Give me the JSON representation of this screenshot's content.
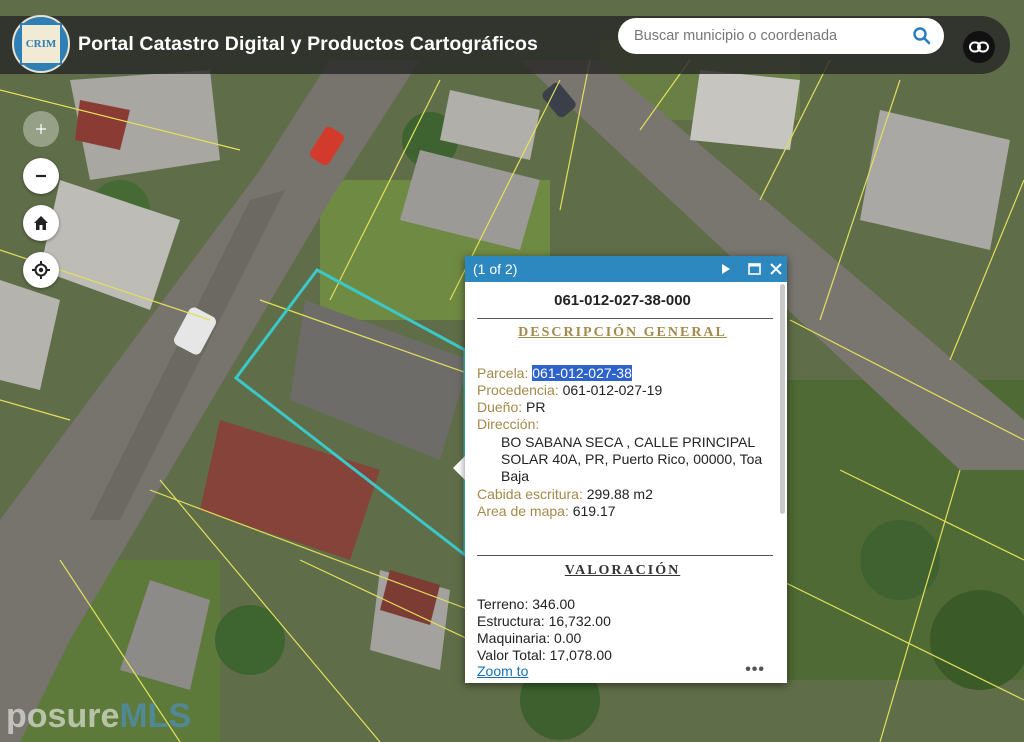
{
  "header": {
    "logo_text": "CRIM",
    "title": "Portal Catastro Digital y Productos Cartográficos",
    "search_placeholder": "Buscar municipio o coordenada",
    "search_icon": "search-icon",
    "link_icon": "link-icon"
  },
  "map_controls": {
    "zoom_in_icon": "plus-icon",
    "zoom_out_icon": "minus-icon",
    "home_icon": "home-icon",
    "locate_icon": "locate-icon"
  },
  "popup": {
    "count": "(1 of 2)",
    "next_icon": "play-icon",
    "maximize_icon": "maximize-icon",
    "close_icon": "close-icon",
    "parcel_id": "061-012-027-38-000",
    "general_title": "DESCRIPCIÓN GENERAL",
    "fields": {
      "parcela_label": "Parcela: ",
      "parcela_value": "061-012-027-38",
      "procedencia_label": "Procedencia: ",
      "procedencia_value": "061-012-027-19",
      "dueno_label": "Dueño: ",
      "dueno_value": "PR",
      "direccion_label": "Dirección: ",
      "direccion_value": "BO SABANA SECA , CALLE PRINCIPAL SOLAR 40A, PR, Puerto Rico, 00000, Toa Baja",
      "cabida_label": "Cabida escritura: ",
      "cabida_value": "299.88 m2",
      "area_label": "Area de mapa: ",
      "area_value": "619.17"
    },
    "valuation_title": "VALORACIÓN",
    "valuation": {
      "terreno": "Terreno: 346.00",
      "estructura": "Estructura: 16,732.00",
      "maquinaria": "Maquinaria: 0.00",
      "total": "Valor Total: 17,078.00"
    },
    "zoom_to": "Zoom to",
    "more": "•••"
  },
  "watermark": {
    "part1": "posure",
    "part2": "MLS"
  },
  "colors": {
    "header_bg": "#282828",
    "popup_header": "#2d88c0",
    "label_gold": "#a48a4a",
    "selection": "#2e63c9",
    "parcel_outline": "#3cc8c8",
    "lot_lines": "#e2e05a"
  }
}
